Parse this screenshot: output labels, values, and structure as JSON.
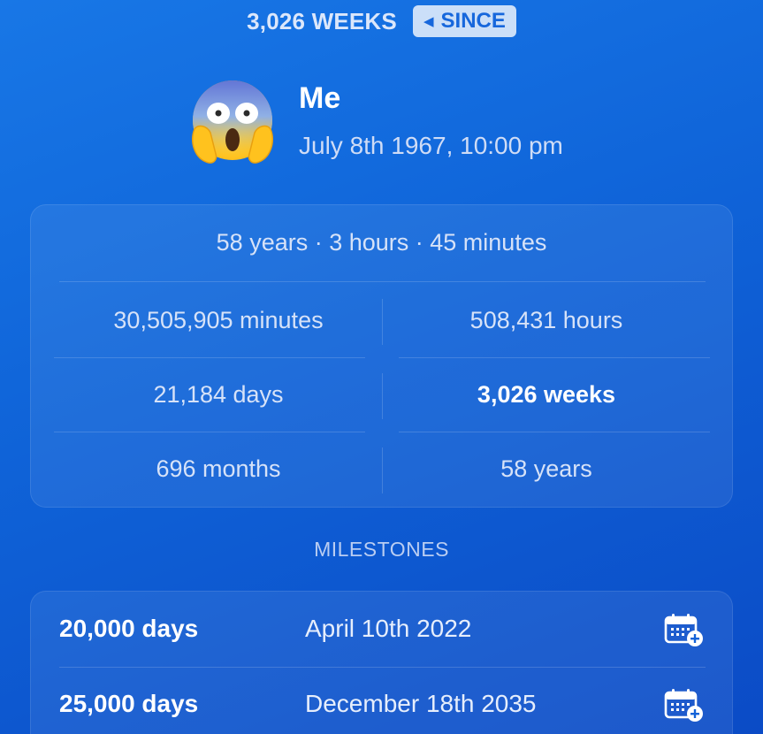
{
  "header": {
    "count_label": "3,026 WEEKS",
    "mode_button": {
      "icon": "left-triangle-icon",
      "label": "SINCE"
    }
  },
  "profile": {
    "avatar_icon": "face-screaming-in-fear-emoji",
    "name": "Me",
    "date": "July 8th 1967, 10:00 pm"
  },
  "stats": {
    "summary": "58 years · 3 hours · 45 minutes",
    "grid": [
      [
        "30,505,905 minutes",
        "508,431 hours"
      ],
      [
        "21,184 days",
        "3,026 weeks"
      ],
      [
        "696 months",
        "58 years"
      ]
    ],
    "highlighted": "3,026 weeks"
  },
  "milestones": {
    "title": "MILESTONES",
    "items": [
      {
        "label": "20,000 days",
        "date": "April 10th 2022",
        "action_icon": "calendar-add-icon"
      },
      {
        "label": "25,000 days",
        "date": "December 18th 2035",
        "action_icon": "calendar-add-icon"
      }
    ]
  },
  "colors": {
    "background_top": "#1877e6",
    "background_bottom": "#0b4bc6",
    "button_text": "#1667dc"
  }
}
